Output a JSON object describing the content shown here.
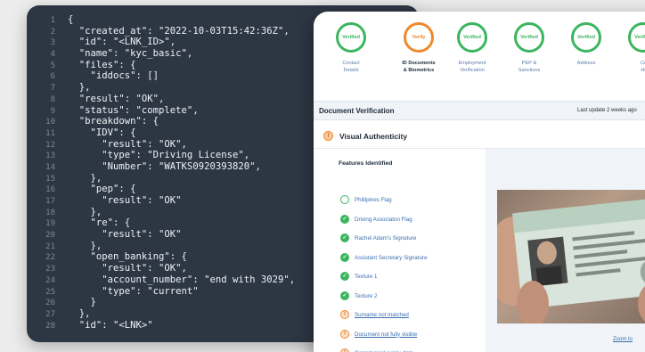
{
  "code": {
    "lines": [
      "{",
      "  \"created_at\": \"2022-10-03T15:42:36Z\",",
      "  \"id\": \"<LNK_ID>\",",
      "  \"name\": \"kyc_basic\",",
      "  \"files\": {",
      "    \"iddocs\": []",
      "  },",
      "  \"result\": \"OK\",",
      "  \"status\": \"complete\",",
      "  \"breakdown\": {",
      "    \"IDV\": {",
      "      \"result\": \"OK\",",
      "      \"type\": \"Driving License\",",
      "      \"Number\": \"WATKS0920393820\",",
      "    },",
      "    \"pep\": {",
      "      \"result\": \"OK\"",
      "    },",
      "    \"re\": {",
      "      \"result\": \"OK\"",
      "    },",
      "    \"open_banking\": {",
      "      \"result\": \"OK\",",
      "      \"account_number\": \"end with 3029\",",
      "      \"type\": \"current\"",
      "    }",
      "  },",
      "  \"id\": \"<LNK>\""
    ]
  },
  "steps": [
    {
      "badge": "Verified",
      "label": "Contact\nDetails",
      "state": "done"
    },
    {
      "badge": "Verify",
      "label": "ID Documents\n& Biometrics",
      "state": "pending"
    },
    {
      "badge": "Verified",
      "label": "Employment\nVerification",
      "state": "done"
    },
    {
      "badge": "Verified",
      "label": "PEP &\nSanctions",
      "state": "done"
    },
    {
      "badge": "Verified",
      "label": "Address",
      "state": "done"
    },
    {
      "badge": "Verified",
      "label": "Cr\nHi",
      "state": "done"
    }
  ],
  "section": {
    "title": "Document Verification",
    "meta": "Last update 2 weeks ago"
  },
  "visual_authenticity": {
    "title": "Visual Authenticity"
  },
  "features": {
    "title": "Features Identified",
    "items": [
      {
        "text": "Phillipines Flag",
        "status": "empty"
      },
      {
        "text": "Driving Associaton Flag",
        "status": "check"
      },
      {
        "text": "Rachel Adam's Signature",
        "status": "check"
      },
      {
        "text": "Assistant Secretary Signature",
        "status": "check"
      },
      {
        "text": "Texture 1",
        "status": "check"
      },
      {
        "text": "Texture 2",
        "status": "check"
      },
      {
        "text": "Surname not matched",
        "status": "warn"
      },
      {
        "text": "Document not fully visible",
        "status": "warn"
      },
      {
        "text": "Cannot read expiry date",
        "status": "warn"
      }
    ]
  },
  "photo": {
    "zoom_label": "Zoom to"
  },
  "colors": {
    "code_bg": "#2d3744",
    "verified_green": "#3cb55f",
    "pending_orange": "#f0892b",
    "link_blue": "#3a6fb0"
  }
}
